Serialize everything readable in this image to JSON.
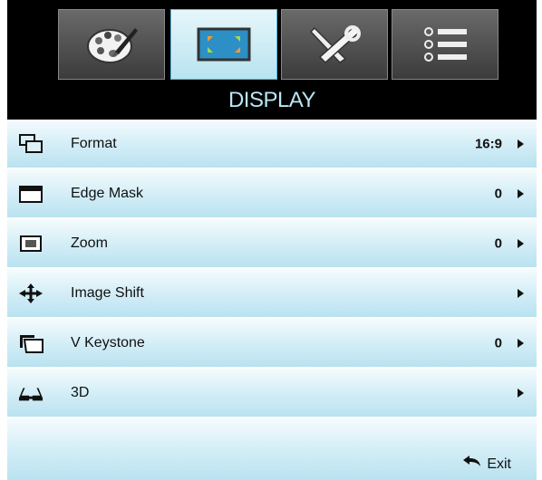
{
  "header": {
    "title": "DISPLAY"
  },
  "tabs": [
    {
      "icon": "palette-icon"
    },
    {
      "icon": "display-icon"
    },
    {
      "icon": "tools-icon"
    },
    {
      "icon": "list-icon"
    }
  ],
  "menu": {
    "items": [
      {
        "label": "Format",
        "value": "16:9",
        "icon": "format-icon"
      },
      {
        "label": "Edge Mask",
        "value": "0",
        "icon": "edge-mask-icon"
      },
      {
        "label": "Zoom",
        "value": "0",
        "icon": "zoom-icon"
      },
      {
        "label": "Image Shift",
        "value": "",
        "icon": "move-icon"
      },
      {
        "label": "V Keystone",
        "value": "0",
        "icon": "keystone-icon"
      },
      {
        "label": "3D",
        "value": "",
        "icon": "3d-glasses-icon"
      }
    ],
    "exit_label": "Exit"
  },
  "colors": {
    "title": "#b9e6f5",
    "active_tab": "#b8e3f0",
    "row": "#d4eef7"
  }
}
